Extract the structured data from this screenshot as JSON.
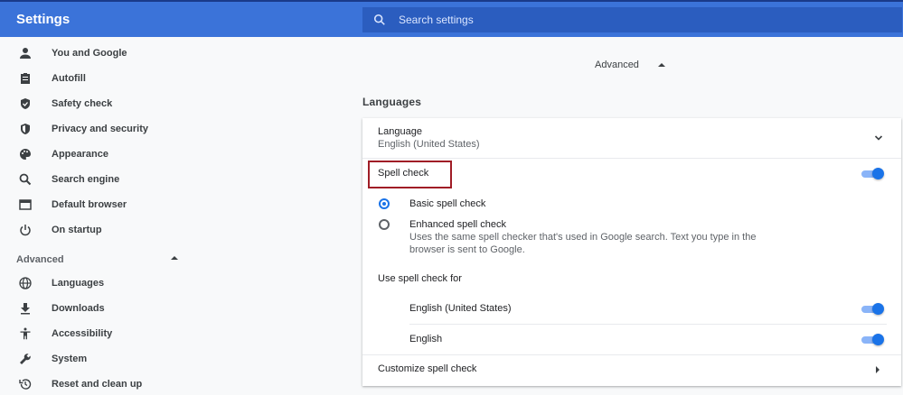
{
  "header": {
    "title": "Settings",
    "search_placeholder": "Search settings"
  },
  "sidebar": {
    "items": [
      {
        "label": "You and Google",
        "icon": "person-icon"
      },
      {
        "label": "Autofill",
        "icon": "clipboard-icon"
      },
      {
        "label": "Safety check",
        "icon": "shield-check-icon"
      },
      {
        "label": "Privacy and security",
        "icon": "shield-icon"
      },
      {
        "label": "Appearance",
        "icon": "palette-icon"
      },
      {
        "label": "Search engine",
        "icon": "search-icon"
      },
      {
        "label": "Default browser",
        "icon": "browser-icon"
      },
      {
        "label": "On startup",
        "icon": "power-icon"
      }
    ],
    "advanced_label": "Advanced",
    "advanced_items": [
      {
        "label": "Languages",
        "icon": "globe-icon"
      },
      {
        "label": "Downloads",
        "icon": "download-icon"
      },
      {
        "label": "Accessibility",
        "icon": "accessibility-icon"
      },
      {
        "label": "System",
        "icon": "wrench-icon"
      },
      {
        "label": "Reset and clean up",
        "icon": "history-icon"
      }
    ]
  },
  "main": {
    "advanced_toggle": "Advanced",
    "section_title": "Languages",
    "language": {
      "title": "Language",
      "value": "English (United States)"
    },
    "spell_check": {
      "label": "Spell check",
      "enabled": true
    },
    "options": {
      "basic": "Basic spell check",
      "enhanced": "Enhanced spell check",
      "enhanced_desc": "Uses the same spell checker that's used in Google search. Text you type in the browser is sent to Google.",
      "selected": "basic"
    },
    "use_for_label": "Use spell check for",
    "languages": [
      {
        "label": "English (United States)",
        "enabled": true
      },
      {
        "label": "English",
        "enabled": true
      }
    ],
    "customize_label": "Customize spell check"
  },
  "colors": {
    "header": "#3b73d9",
    "accent": "#1a73e8",
    "highlight": "#a01d26"
  }
}
